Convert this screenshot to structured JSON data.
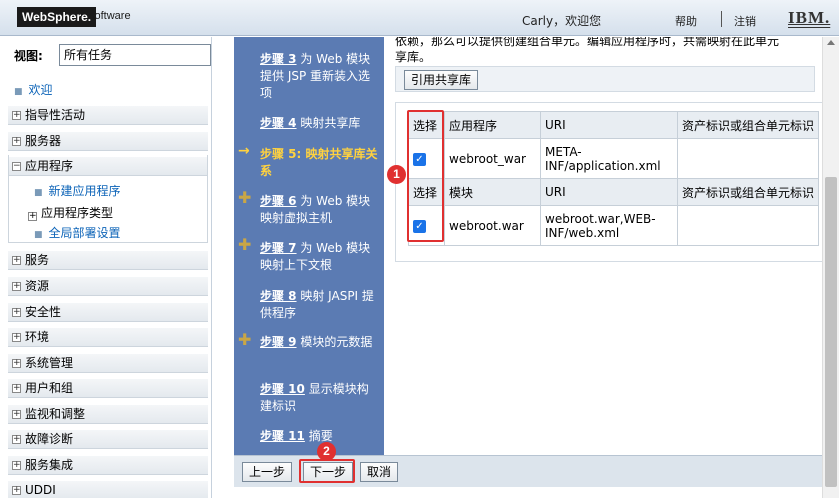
{
  "header": {
    "logo": "WebSphere.",
    "logo_sub": "software",
    "greeting": "Carly，欢迎您",
    "help": "帮助",
    "logout": "注销",
    "vendor": "IBM."
  },
  "leftnav": {
    "view_label": "视图:",
    "view_value": "所有任务",
    "welcome": "欢迎",
    "categories": [
      "指导性活动",
      "服务器",
      "应用程序",
      "服务",
      "资源",
      "安全性",
      "环境",
      "系统管理",
      "用户和组",
      "监视和调整",
      "故障诊断",
      "服务集成",
      "UDDI"
    ],
    "app_children": {
      "new_app": "新建应用程序",
      "app_types": "应用程序类型",
      "global_deploy": "全局部署设置"
    }
  },
  "steps": [
    {
      "num": "步骤 3",
      "text": " 为 Web 模块提供 JSP 重新装入选项"
    },
    {
      "num": "步骤 4",
      "text": " 映射共享库"
    },
    {
      "num": "步骤 5:",
      "text": " 映射共享库关系"
    },
    {
      "num": "步骤 6",
      "text": " 为 Web 模块映射虚拟主机"
    },
    {
      "num": "步骤 7",
      "text": " 为 Web 模块映射上下文根"
    },
    {
      "num": "步骤 8",
      "text": " 映射 JASPI 提供程序"
    },
    {
      "num": "步骤 9",
      "text": " 模块的元数据"
    },
    {
      "num": "步骤 10",
      "text": " 显示模块构建标识"
    },
    {
      "num": "步骤 11",
      "text": " 摘要"
    }
  ],
  "content": {
    "intro_line1": "依赖，那么可以提供创建组合单元。编辑应用程序时，共需映射在此单元",
    "intro_line2": "享库。",
    "reference_button": "引用共享库",
    "table1_headers": [
      "选择",
      "应用程序",
      "URI",
      "资产标识或组合单元标识"
    ],
    "table1_row": {
      "name": "webroot_war",
      "uri": "META-INF/application.xml"
    },
    "table2_headers": [
      "选择",
      "模块",
      "URI",
      "资产标识或组合单元标识"
    ],
    "table2_row": {
      "name": "webroot.war",
      "uri": "webroot.war,WEB-INF/web.xml"
    }
  },
  "buttons": {
    "previous": "上一步",
    "next": "下一步",
    "cancel": "取消"
  },
  "annotations": {
    "marker1": "1",
    "marker2": "2"
  }
}
